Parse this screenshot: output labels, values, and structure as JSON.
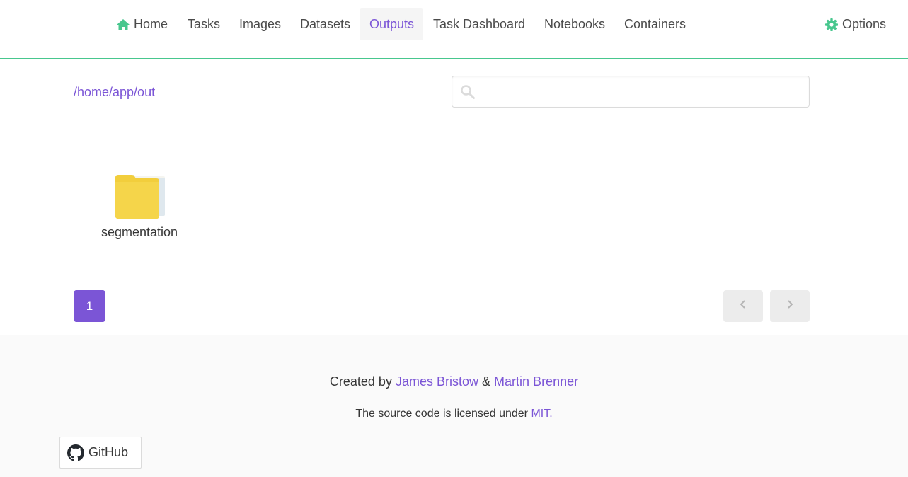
{
  "nav": {
    "home": "Home",
    "tasks": "Tasks",
    "images": "Images",
    "datasets": "Datasets",
    "outputs": "Outputs",
    "task_dashboard": "Task Dashboard",
    "notebooks": "Notebooks",
    "containers": "Containers",
    "options": "Options"
  },
  "path": "/home/app/out",
  "search": {
    "value": "",
    "placeholder": ""
  },
  "files": [
    {
      "name": "segmentation",
      "icon": "folder-icon"
    }
  ],
  "pagination": {
    "current_page": "1"
  },
  "footer": {
    "created_by": "Created by",
    "author1": "James Bristow",
    "and": "&",
    "author2": "Martin Brenner",
    "license_text": "The source code is licensed under",
    "license_link": "MIT.",
    "github": "GitHub"
  },
  "colors": {
    "accent": "#7b55d6",
    "nav_icon": "#48c78e",
    "navbar_border": "#48c78e"
  }
}
